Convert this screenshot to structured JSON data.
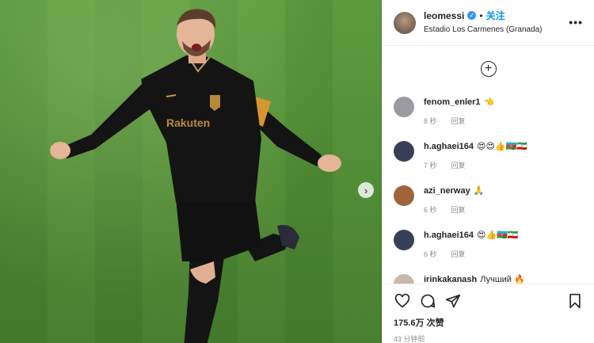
{
  "post": {
    "username": "leomessi",
    "follow_label": "关注",
    "location": "Estadio Los Carmenes (Granada)",
    "more_label": "•••",
    "add_label": "+",
    "next_label": "›"
  },
  "comments": [
    {
      "user": "fenom_enler1",
      "text": "👈",
      "time": "8 秒",
      "reply": "回复",
      "avatar_color": "#9a9aa0"
    },
    {
      "user": "h.aghaei164",
      "text": "😍😍👍🇦🇿🇮🇷",
      "time": "7 秒",
      "reply": "回复",
      "avatar_color": "#3a3f58"
    },
    {
      "user": "azi_nerway",
      "text": "🙏",
      "time": "6 秒",
      "reply": "回复",
      "avatar_color": "#a0643c"
    },
    {
      "user": "h.aghaei164",
      "text": "😍👍🇦🇿🇮🇷",
      "time": "6 秒",
      "reply": "回复",
      "avatar_color": "#3a3f58"
    },
    {
      "user": "irinkakanash",
      "text": "Лучший 🔥",
      "time": "",
      "reply": "",
      "avatar_color": "#c9b7a8"
    }
  ],
  "footer": {
    "likes": "175.6万 次赞",
    "time_ago": "43 分钟前"
  },
  "colors": {
    "accent": "#0095f6",
    "verified": "#3897f0",
    "pitch": "#5fa140",
    "kit": "#141414",
    "kit_trim": "#c79a4a"
  }
}
